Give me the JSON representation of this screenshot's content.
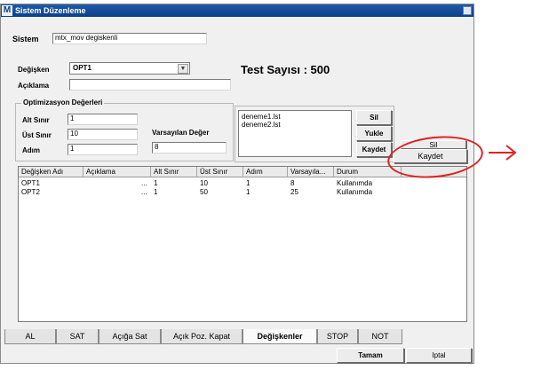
{
  "window": {
    "title": "Sistem Düzenleme",
    "app_icon": "M"
  },
  "sistem": {
    "label": "Sistem",
    "value": "mtx_mov degiskenli"
  },
  "degisken": {
    "label": "Değişken",
    "selected": "OPT1"
  },
  "aciklama": {
    "label": "Açıklama",
    "value": ""
  },
  "test_count": "Test Sayısı : 500",
  "optimization": {
    "title": "Optimizasyon Değerleri",
    "alt_sinir_label": "Alt Sınır",
    "alt_sinir_value": "1",
    "ust_sinir_label": "Üst Sınır",
    "ust_sinir_value": "10",
    "adim_label": "Adım",
    "adim_value": "1",
    "varsayilan_label": "Varsayılan Değer",
    "varsayilan_value": "8"
  },
  "lists": {
    "items": [
      "deneme1.lst",
      "deneme2.lst"
    ]
  },
  "list_buttons": {
    "sil": "Sil",
    "yukle": "Yukle",
    "kaydet": "Kaydet"
  },
  "extra_buttons": {
    "sil": "Sil",
    "kaydet": "Kaydet"
  },
  "grid": {
    "columns": [
      "Değişken Adı",
      "Açıklama",
      "Alt Sınır",
      "Üst Sınır",
      "Adım",
      "Varsayıla...",
      "Durum"
    ],
    "rows": [
      {
        "name": "OPT1",
        "desc": "...",
        "alt": "1",
        "ust": "10",
        "adim": "1",
        "varsayilan": "8",
        "durum": "Kullanımda"
      },
      {
        "name": "OPT2",
        "desc": "...",
        "alt": "1",
        "ust": "50",
        "adim": "1",
        "varsayilan": "25",
        "durum": "Kullanımda"
      }
    ]
  },
  "tabs": [
    "AL",
    "SAT",
    "Açığa Sat",
    "Açık Poz. Kapat",
    "Değişkenler",
    "STOP",
    "NOT"
  ],
  "active_tab": "Değişkenler",
  "footer": {
    "ok": "Tamam",
    "cancel": "Iptal"
  },
  "annotation_color": "#e02020"
}
